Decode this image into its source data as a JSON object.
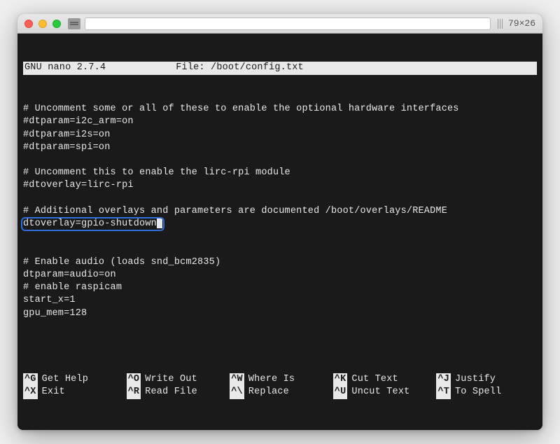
{
  "window": {
    "dimensions": "79×26"
  },
  "nano": {
    "version": "GNU nano 2.7.4",
    "file_label": "File: /boot/config.txt"
  },
  "content": {
    "l1": "# Uncomment some or all of these to enable the optional hardware interfaces",
    "l2": "#dtparam=i2c_arm=on",
    "l3": "#dtparam=i2s=on",
    "l4": "#dtparam=spi=on",
    "l5": "# Uncomment this to enable the lirc-rpi module",
    "l6": "#dtoverlay=lirc-rpi",
    "l7": "# Additional overlays and parameters are documented /boot/overlays/README",
    "l8": "dtoverlay=gpio-shutdown",
    "l9": "# Enable audio (loads snd_bcm2835)",
    "l10": "dtparam=audio=on",
    "l11": "# enable raspicam",
    "l12": "start_x=1",
    "l13": "gpu_mem=128"
  },
  "shortcuts": [
    {
      "key": "^G",
      "label": "Get Help"
    },
    {
      "key": "^X",
      "label": "Exit"
    },
    {
      "key": "^O",
      "label": "Write Out"
    },
    {
      "key": "^R",
      "label": "Read File"
    },
    {
      "key": "^W",
      "label": "Where Is"
    },
    {
      "key": "^\\",
      "label": "Replace"
    },
    {
      "key": "^K",
      "label": "Cut Text"
    },
    {
      "key": "^U",
      "label": "Uncut Text"
    },
    {
      "key": "^J",
      "label": "Justify"
    },
    {
      "key": "^T",
      "label": "To Spell"
    }
  ]
}
